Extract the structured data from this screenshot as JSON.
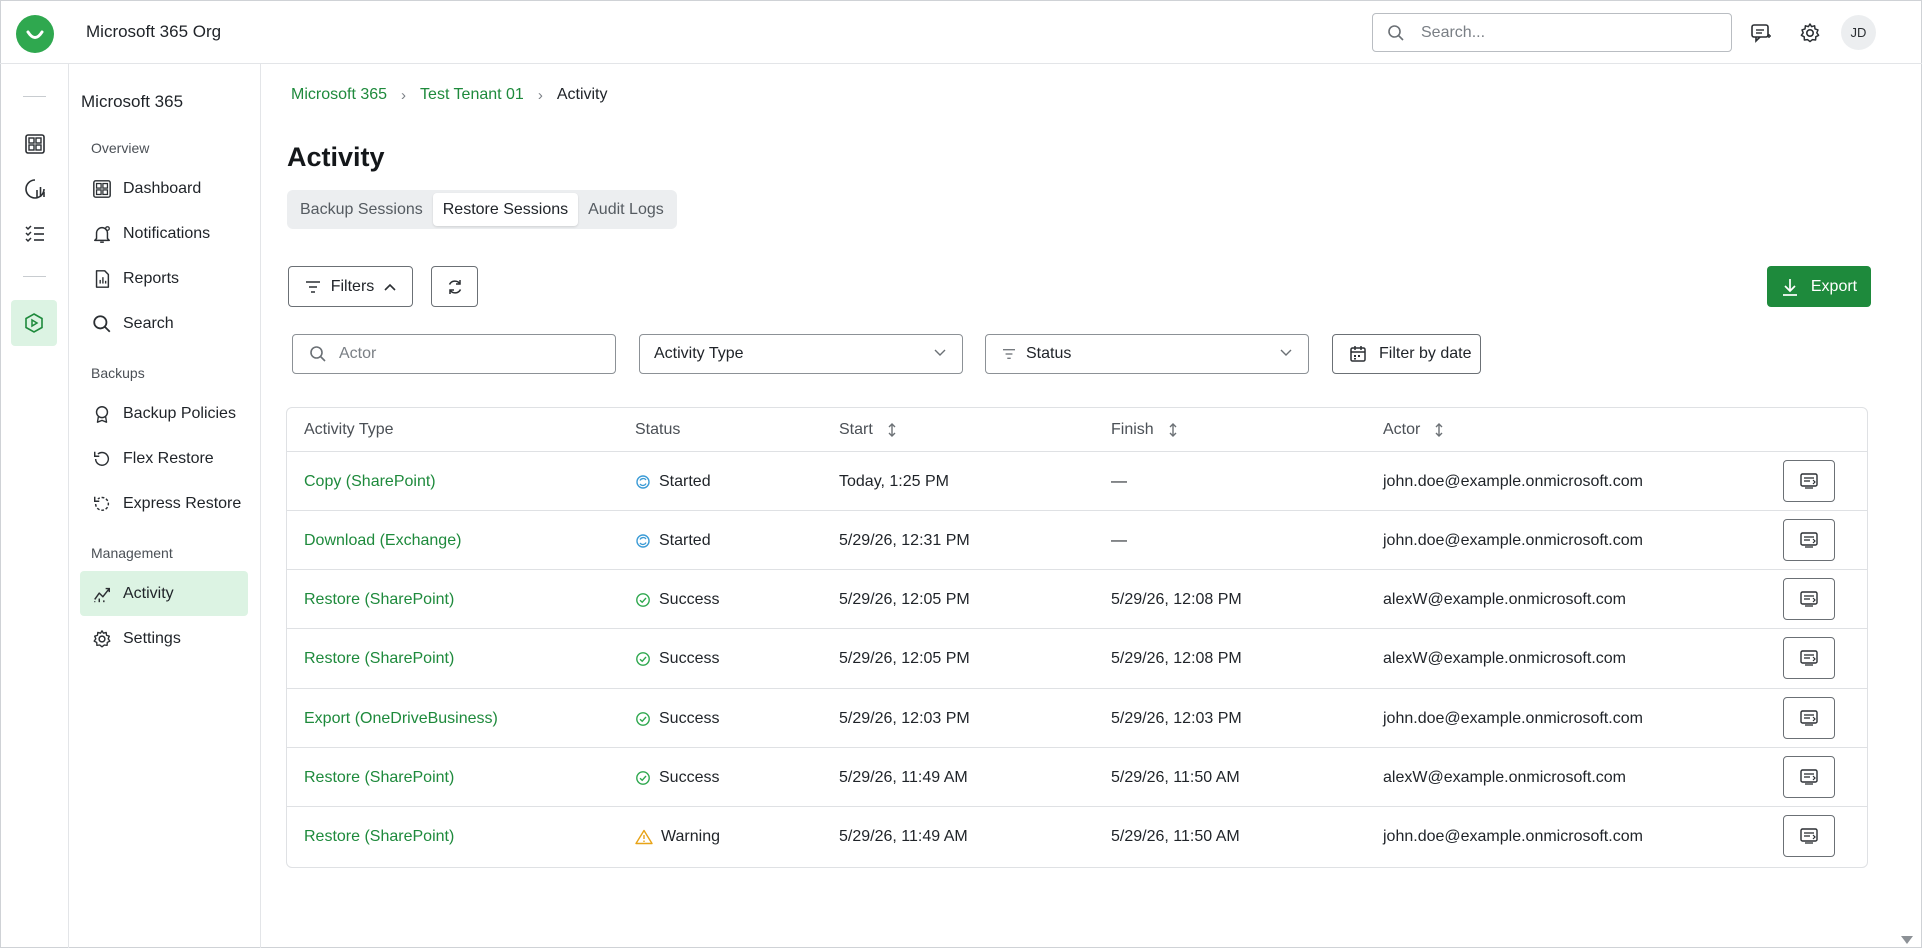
{
  "app": {
    "org_name": "Microsoft 365 Org",
    "user_initials": "JD"
  },
  "search": {
    "placeholder": "Search..."
  },
  "nav": {
    "title": "Microsoft 365",
    "sections": {
      "overview": "Overview",
      "backups": "Backups",
      "management": "Management"
    },
    "items": [
      {
        "label": "Dashboard",
        "icon": "dashboard-icon"
      },
      {
        "label": "Notifications",
        "icon": "bell-icon"
      },
      {
        "label": "Reports",
        "icon": "report-icon"
      },
      {
        "label": "Search",
        "icon": "search-icon"
      },
      {
        "label": "Backup Policies",
        "icon": "policy-icon"
      },
      {
        "label": "Flex Restore",
        "icon": "restore-icon"
      },
      {
        "label": "Express Restore",
        "icon": "express-restore-icon"
      },
      {
        "label": "Activity",
        "icon": "activity-icon",
        "active": true
      },
      {
        "label": "Settings",
        "icon": "gear-icon"
      }
    ]
  },
  "breadcrumb": [
    "Microsoft 365",
    "Test Tenant 01",
    "Activity"
  ],
  "page": {
    "title": "Activity"
  },
  "tabs": [
    {
      "label": "Backup Sessions"
    },
    {
      "label": "Restore Sessions",
      "active": true
    },
    {
      "label": "Audit Logs"
    }
  ],
  "toolbar": {
    "filters_label": "Filters",
    "export_label": "Export"
  },
  "filters": {
    "actor_placeholder": "Actor",
    "activity_type": "Activity Type",
    "status": "Status",
    "date_label": "Filter by date"
  },
  "table": {
    "columns": [
      "Activity Type",
      "Status",
      "Start",
      "Finish",
      "Actor"
    ],
    "rows": [
      {
        "activity": "Copy (SharePoint)",
        "status": "Started",
        "start": "Today, 1:25 PM",
        "finish": "—",
        "actor": "john.doe@example.onmicrosoft.com"
      },
      {
        "activity": "Download (Exchange)",
        "status": "Started",
        "start": "5/29/26, 12:31 PM",
        "finish": "—",
        "actor": "john.doe@example.onmicrosoft.com"
      },
      {
        "activity": "Restore (SharePoint)",
        "status": "Success",
        "start": "5/29/26, 12:05 PM",
        "finish": "5/29/26, 12:08 PM",
        "actor": "alexW@example.onmicrosoft.com"
      },
      {
        "activity": "Restore (SharePoint)",
        "status": "Success",
        "start": "5/29/26, 12:05 PM",
        "finish": "5/29/26, 12:08 PM",
        "actor": "alexW@example.onmicrosoft.com"
      },
      {
        "activity": "Export (OneDriveBusiness)",
        "status": "Success",
        "start": "5/29/26, 12:03 PM",
        "finish": "5/29/26, 12:03 PM",
        "actor": "john.doe@example.onmicrosoft.com"
      },
      {
        "activity": "Restore (SharePoint)",
        "status": "Success",
        "start": "5/29/26, 11:49 AM",
        "finish": "5/29/26, 11:50 AM",
        "actor": "alexW@example.onmicrosoft.com"
      },
      {
        "activity": "Restore (SharePoint)",
        "status": "Warning",
        "start": "5/29/26, 11:49 AM",
        "finish": "5/29/26, 11:50 AM",
        "actor": "john.doe@example.onmicrosoft.com"
      }
    ]
  },
  "colors": {
    "accent": "#1e8a3c",
    "accent_light": "#dcf3e3",
    "warning": "#e8a317",
    "started": "#3b9bd6"
  }
}
